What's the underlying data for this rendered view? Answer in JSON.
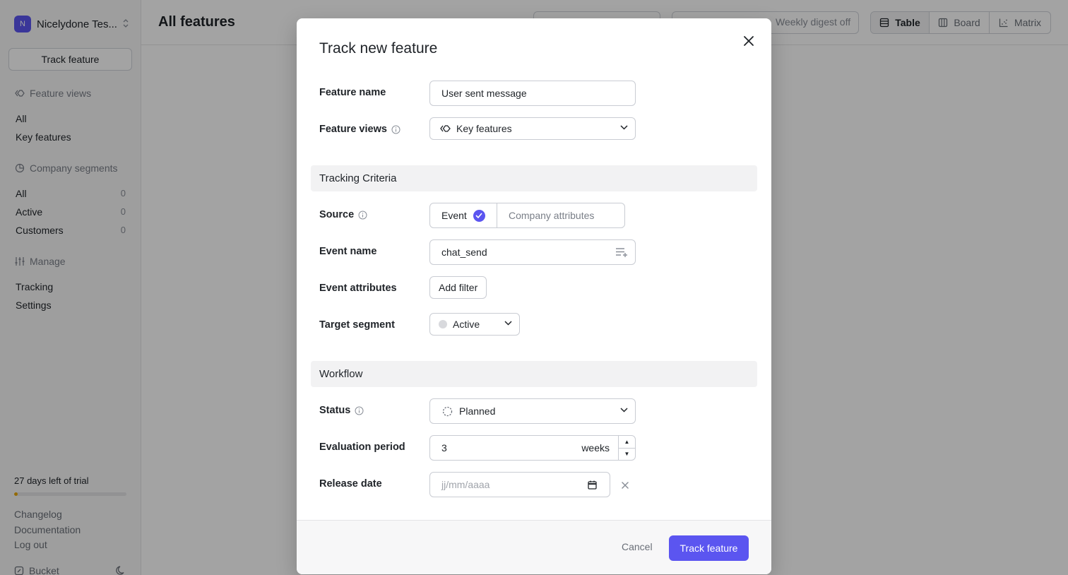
{
  "sidebar": {
    "org_initial": "N",
    "org_name": "Nicelydone Tes...",
    "track_button": "Track feature",
    "feature_views": {
      "title": "Feature views",
      "items": [
        {
          "label": "All"
        },
        {
          "label": "Key features"
        }
      ]
    },
    "company_segments": {
      "title": "Company segments",
      "items": [
        {
          "label": "All",
          "count": "0"
        },
        {
          "label": "Active",
          "count": "0"
        },
        {
          "label": "Customers",
          "count": "0"
        }
      ]
    },
    "manage": {
      "title": "Manage",
      "items": [
        {
          "label": "Tracking"
        },
        {
          "label": "Settings"
        }
      ]
    },
    "trial_text": "27 days left of trial",
    "trial_progress_fraction": 0.03,
    "footer_links": [
      {
        "label": "Changelog"
      },
      {
        "label": "Documentation"
      },
      {
        "label": "Log out"
      }
    ],
    "brand": "Bucket"
  },
  "header": {
    "title": "All features",
    "digest": "Weekly digest off",
    "views": [
      {
        "label": "Table",
        "icon": "table-icon",
        "active": true
      },
      {
        "label": "Board",
        "icon": "board-icon",
        "active": false
      },
      {
        "label": "Matrix",
        "icon": "matrix-icon",
        "active": false
      }
    ]
  },
  "modal": {
    "title": "Track new feature",
    "feature_name": {
      "label": "Feature name",
      "value": "User sent message"
    },
    "feature_views": {
      "label": "Feature views",
      "value": "Key features"
    },
    "tracking_section": "Tracking Criteria",
    "source": {
      "label": "Source",
      "options": [
        "Event",
        "Company attributes"
      ],
      "selected": "Event"
    },
    "event_name": {
      "label": "Event name",
      "value": "chat_send"
    },
    "event_attributes": {
      "label": "Event attributes",
      "button": "Add filter"
    },
    "target_segment": {
      "label": "Target segment",
      "value": "Active"
    },
    "workflow_section": "Workflow",
    "status": {
      "label": "Status",
      "value": "Planned"
    },
    "evaluation_period": {
      "label": "Evaluation period",
      "value": "3",
      "unit": "weeks"
    },
    "release_date": {
      "label": "Release date",
      "placeholder": "jj/mm/aaaa"
    },
    "cancel": "Cancel",
    "submit": "Track feature"
  },
  "colors": {
    "accent": "#5b55f0",
    "trial_progress": "#e8a700",
    "overlay": "rgba(0,0,0,0.36)"
  }
}
